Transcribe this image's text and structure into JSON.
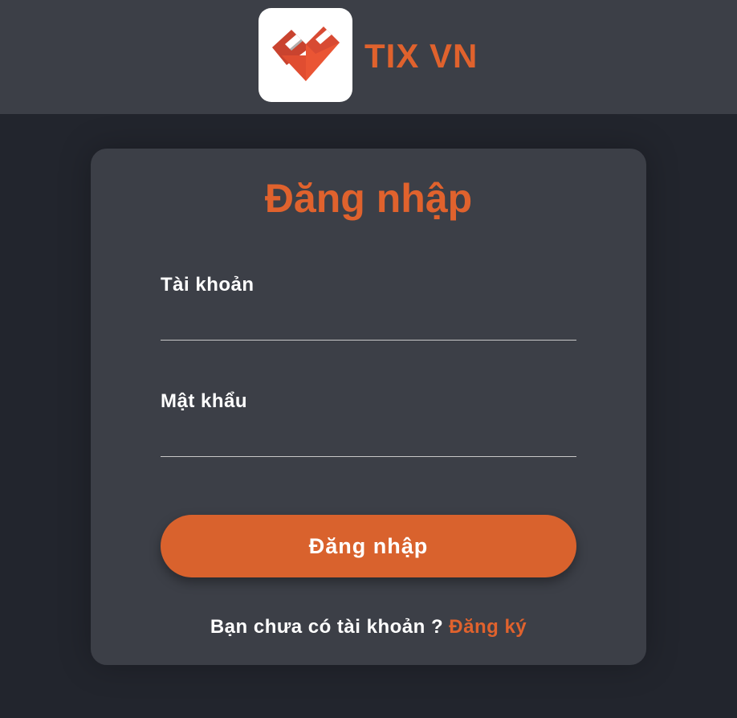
{
  "header": {
    "logo_icon": "folded-heart-logo-icon",
    "brand": "TIX VN"
  },
  "login": {
    "title": "Đăng nhập",
    "username": {
      "label": "Tài khoản",
      "value": ""
    },
    "password": {
      "label": "Mật khẩu",
      "value": ""
    },
    "submit_label": "Đăng nhập",
    "signup_prompt": "Bạn chưa có tài khoản ?",
    "signup_link": "Đăng ký"
  },
  "colors": {
    "accent": "#e0622d",
    "button": "#d9622d",
    "header_bg": "#3c3f47",
    "page_bg": "#22252d",
    "card_bg": "#3c3f47"
  }
}
